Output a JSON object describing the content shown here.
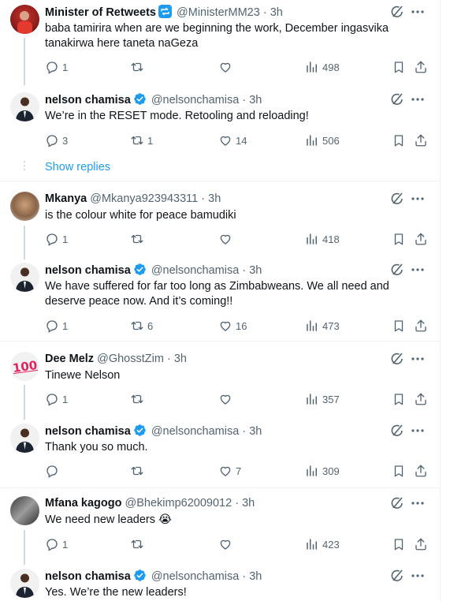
{
  "icons": {
    "reply": "reply-icon",
    "retweet": "retweet-icon",
    "like": "heart-icon",
    "views": "views-icon",
    "bookmark": "bookmark-icon",
    "share": "share-icon",
    "grok": "grok-icon",
    "more": "more-icon",
    "verified": "verified-badge-icon"
  },
  "colors": {
    "link": "#1d9bf0",
    "secondary": "#536471",
    "verified": "#1d9bf0",
    "thread_line": "#cfd9de"
  },
  "show_replies": "Show replies",
  "tweets": [
    {
      "name": "Minister of Retweets",
      "handle": "@MinisterMM23",
      "time": "3h",
      "sep": "·",
      "text": "baba tamirira when are we beginning the work, December ingasvika tanakirwa here taneta naGeza",
      "replies": "1",
      "retweets": "",
      "likes": "",
      "views": "498",
      "badge": "retweet"
    },
    {
      "name": "nelson chamisa",
      "handle": "@nelsonchamisa",
      "time": "3h",
      "sep": "·",
      "text": "We’re in the RESET mode. Retooling and reloading!",
      "replies": "3",
      "retweets": "1",
      "likes": "14",
      "views": "506",
      "badge": "verified"
    },
    {
      "name": "Mkanya",
      "handle": "@Mkanya923943311",
      "time": "3h",
      "sep": "·",
      "text": "is the colour white for peace bamudiki",
      "replies": "1",
      "retweets": "",
      "likes": "",
      "views": "418",
      "badge": ""
    },
    {
      "name": "nelson chamisa",
      "handle": "@nelsonchamisa",
      "time": "3h",
      "sep": "·",
      "text": "We have suffered for far too long as Zimbabweans. We all need and deserve peace now. And it’s coming!!",
      "replies": "1",
      "retweets": "6",
      "likes": "16",
      "views": "473",
      "badge": "verified"
    },
    {
      "name": "Dee Melz",
      "handle": "@GhosstZim",
      "time": "3h",
      "sep": "·",
      "text": "Tinewe Nelson",
      "replies": "1",
      "retweets": "",
      "likes": "",
      "views": "357",
      "badge": "",
      "avatar_text": "100"
    },
    {
      "name": "nelson chamisa",
      "handle": "@nelsonchamisa",
      "time": "3h",
      "sep": "·",
      "text": "Thank you so much.",
      "replies": "",
      "retweets": "",
      "likes": "7",
      "views": "309",
      "badge": "verified"
    },
    {
      "name": "Mfana kagogo",
      "handle": "@Bhekimp62009012",
      "time": "3h",
      "sep": "·",
      "text": "We need new leaders 😭",
      "replies": "1",
      "retweets": "",
      "likes": "",
      "views": "423",
      "badge": ""
    },
    {
      "name": "nelson chamisa",
      "handle": "@nelsonchamisa",
      "time": "3h",
      "sep": "·",
      "text": "Yes. We’re the new leaders!",
      "replies": "",
      "retweets": "",
      "likes": "",
      "views": "",
      "badge": "verified"
    }
  ]
}
